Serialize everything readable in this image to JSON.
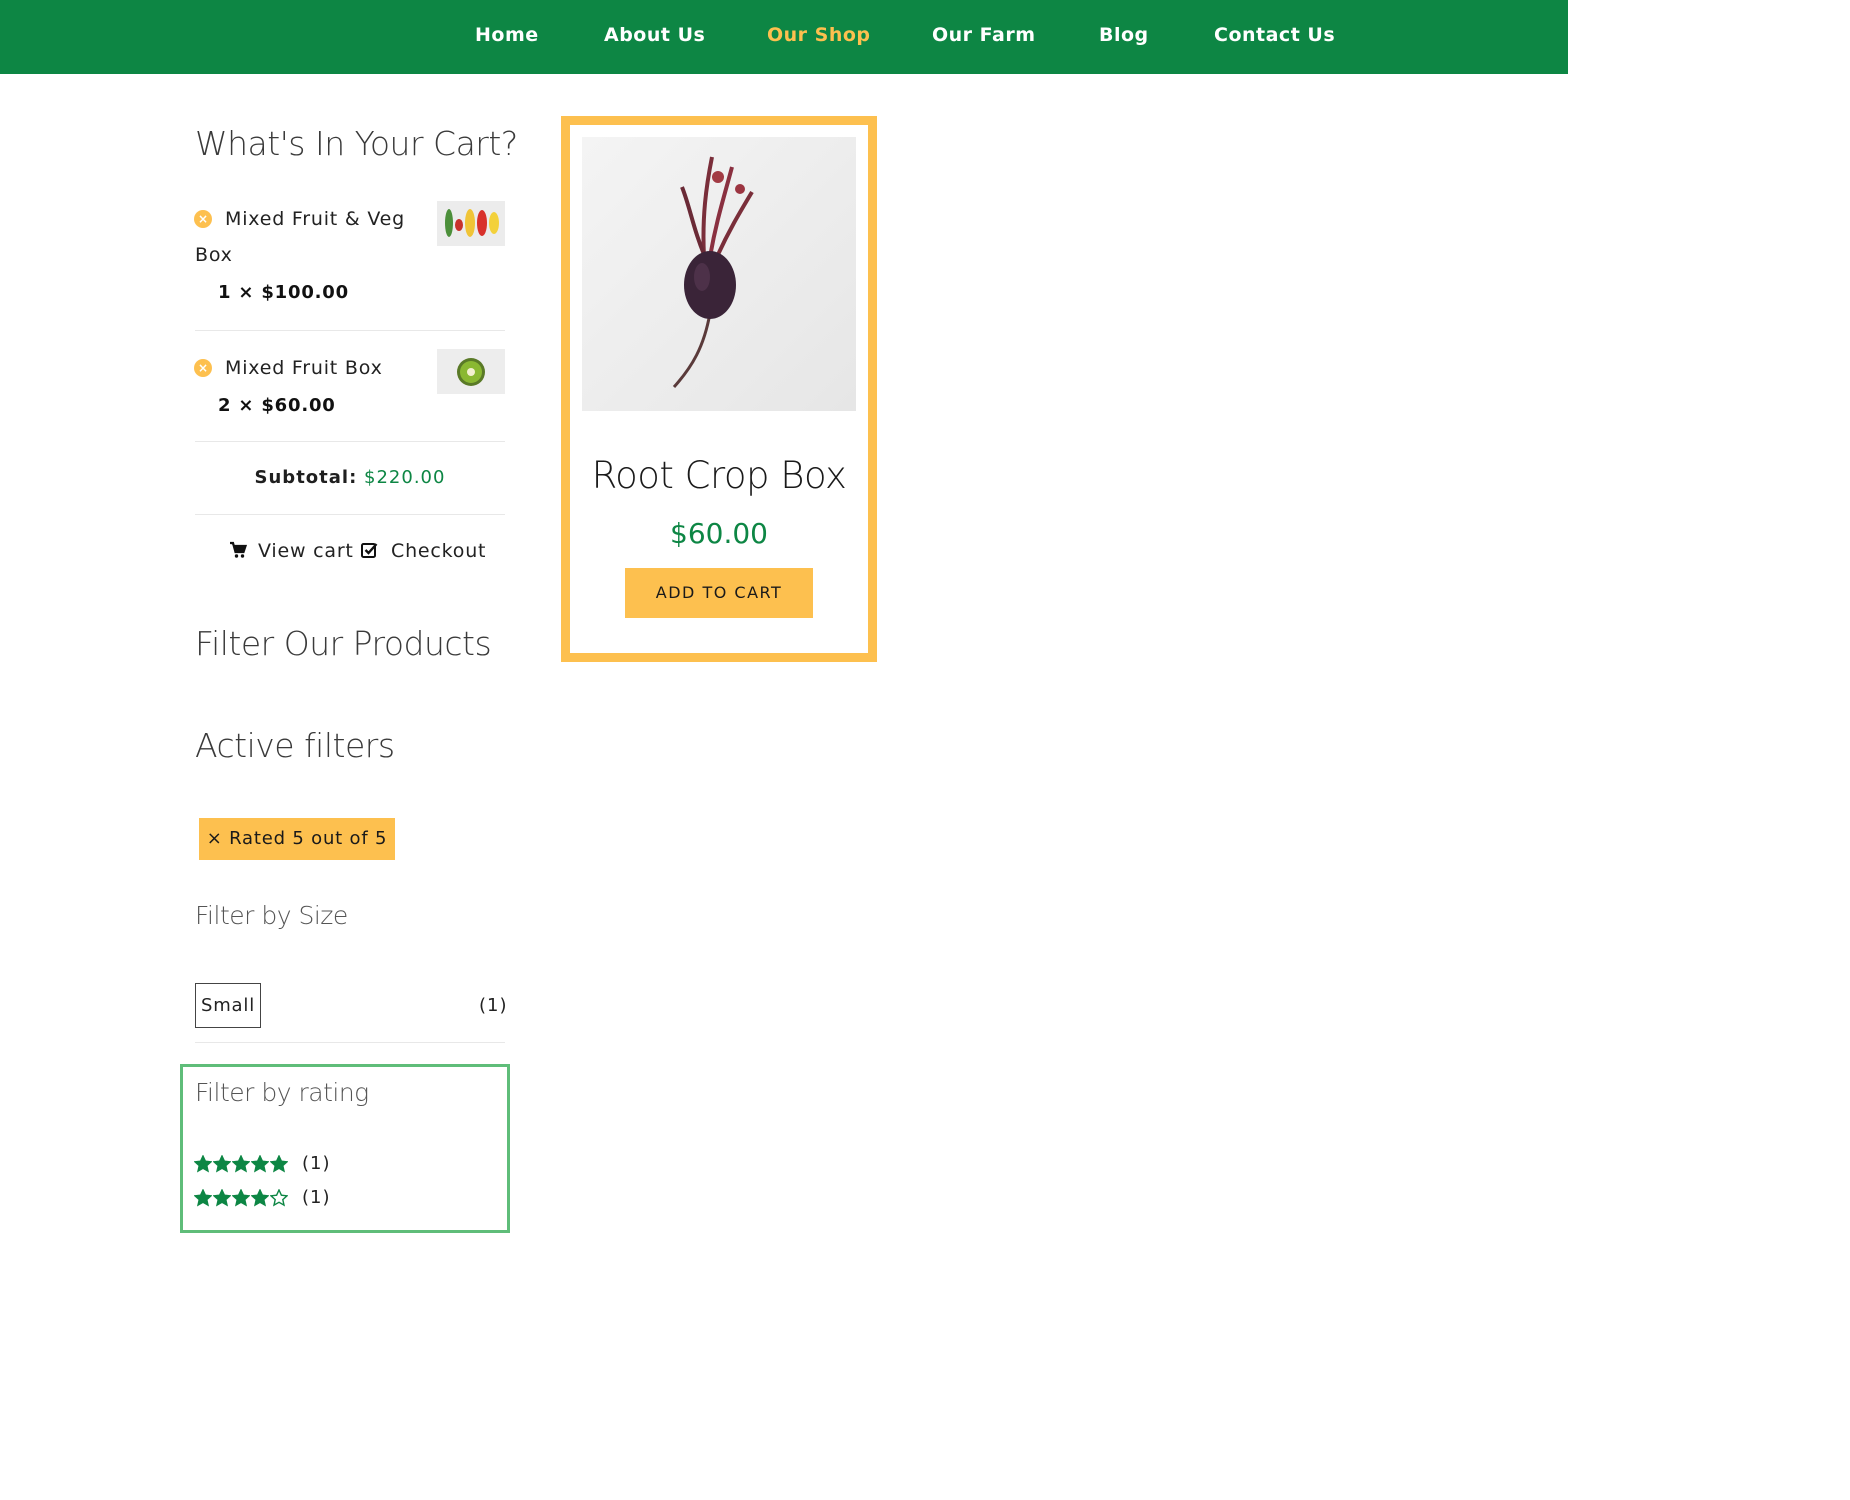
{
  "nav": {
    "items": [
      "Home",
      "About Us",
      "Our Shop",
      "Our Farm",
      "Blog",
      "Contact Us"
    ],
    "active": "Our Shop"
  },
  "cart": {
    "heading": "What's In Your Cart?",
    "items": [
      {
        "name_line1": "Mixed Fruit & Veg",
        "name_line2": "Box",
        "quantity": "1 × $100.00"
      },
      {
        "name_line1": "Mixed Fruit Box",
        "quantity": "2 × $60.00"
      }
    ],
    "subtotal_label": "Subtotal:",
    "subtotal_value": "$220.00",
    "view_cart": "View cart",
    "checkout": "Checkout"
  },
  "filters": {
    "heading": "Filter Our Products",
    "active_heading": "Active filters",
    "active_chip": "Rated 5 out of 5",
    "size_heading": "Filter by Size",
    "size_option": "Small",
    "size_count": "(1)",
    "rating_heading": "Filter by rating",
    "rating_rows": [
      {
        "stars": 5,
        "count": "(1)"
      },
      {
        "stars": 4,
        "count": "(1)"
      }
    ]
  },
  "product": {
    "name": "Root Crop Box",
    "price": "$60.00",
    "button": "ADD TO CART"
  },
  "colors": {
    "brand_green": "#0d8644",
    "accent_yellow": "#fdc04f",
    "highlight_green": "#5fbd79"
  }
}
